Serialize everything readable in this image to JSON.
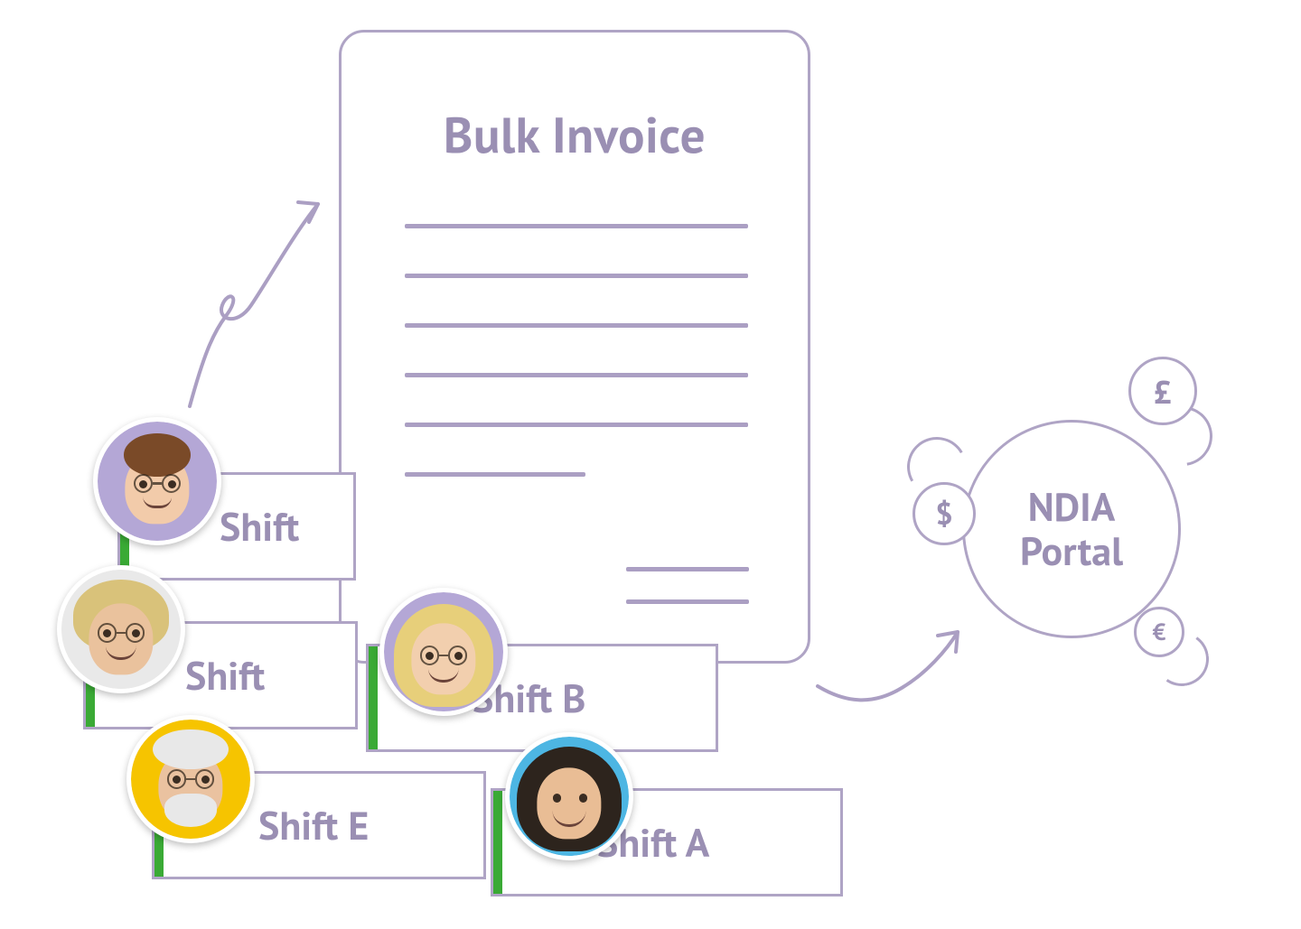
{
  "invoice": {
    "title": "Bulk Invoice"
  },
  "shifts": {
    "c": {
      "label": "Shift"
    },
    "d": {
      "label": "Shift"
    },
    "e": {
      "label": "Shift E"
    },
    "b": {
      "label": "Shift B"
    },
    "a": {
      "label": "Shift A"
    }
  },
  "portal": {
    "line1": "NDIA",
    "line2": "Portal",
    "coins": {
      "dollar": "$",
      "pound": "£",
      "euro": "€"
    }
  },
  "avatars": {
    "c": {
      "bg": "#b4a7d6",
      "skin": "#f2cbaa",
      "hair": "#7a4a28"
    },
    "d": {
      "bg": "#e9e9e9",
      "skin": "#eac29d",
      "hair": "#d9c27a"
    },
    "e": {
      "bg": "#f6c400",
      "skin": "#eac2a0",
      "hair": "#e8e8e8"
    },
    "b": {
      "bg": "#b4a7d6",
      "skin": "#f2cfae",
      "hair": "#e7cf7a"
    },
    "a": {
      "bg": "#4db6e3",
      "skin": "#e9bd95",
      "hair": "#2d241d"
    }
  }
}
